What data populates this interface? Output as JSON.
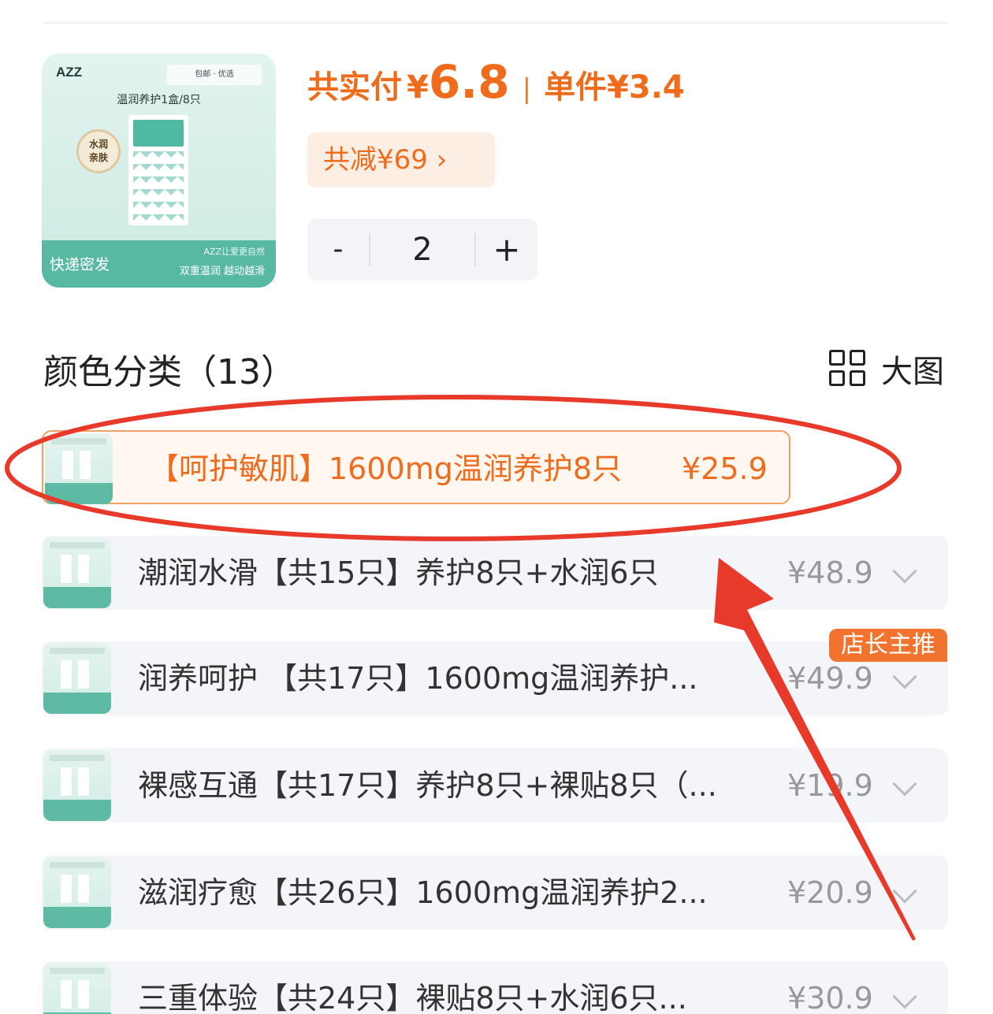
{
  "product_image": {
    "brand": "AZZ",
    "badges": "包邮 · 优选",
    "title": "温润养护1盒/8只",
    "seal": "水润\n亲肤",
    "footer_left": "快递密发",
    "footer_right_top": "AZZ让爱更自然",
    "footer_right_bottom": "双重温润 越动越滑"
  },
  "price": {
    "total_label": "共实付",
    "currency": "¥",
    "total_value": "6.8",
    "separator": "|",
    "unit_label": "单件¥3.4"
  },
  "discount": {
    "label": "共减¥69 ›"
  },
  "quantity": {
    "minus": "-",
    "value": "2",
    "plus": "+"
  },
  "section": {
    "title": "颜色分类（13）",
    "big_view_label": "大图",
    "big_view_icon": "grid-icon"
  },
  "variants": [
    {
      "label": "【呵护敏肌】1600mg温润养护8只",
      "price": "¥25.9",
      "selected": true
    },
    {
      "label": "潮润水滑【共15只】养护8只+水润6只",
      "price": "¥48.9",
      "selected": false
    },
    {
      "label": "润养呵护 【共17只】1600mg温润养护...",
      "price": "¥49.9",
      "selected": false
    },
    {
      "label": "裸感互通【共17只】养护8只+裸贴8只（...",
      "price": "¥19.9",
      "selected": false
    },
    {
      "label": "滋润疗愈【共26只】1600mg温润养护2...",
      "price": "¥20.9",
      "selected": false
    },
    {
      "label": "三重体验【共24只】裸贴8只+水润6只...",
      "price": "¥30.9",
      "selected": false
    }
  ],
  "badge": {
    "label": "店长主推"
  },
  "colors": {
    "accent": "#f06c1d",
    "annotation": "#e83a2a",
    "row_bg": "#f3f5f9"
  }
}
